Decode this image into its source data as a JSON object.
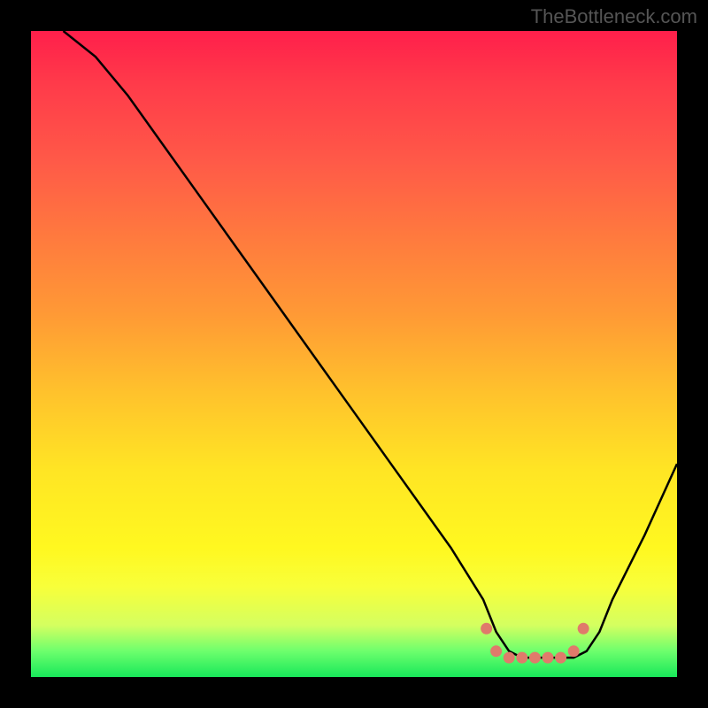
{
  "watermark": "TheBottleneck.com",
  "chart_data": {
    "type": "line",
    "title": "",
    "xlabel": "",
    "ylabel": "",
    "xlim": [
      0,
      100
    ],
    "ylim": [
      0,
      100
    ],
    "x": [
      5,
      10,
      15,
      20,
      25,
      30,
      35,
      40,
      45,
      50,
      55,
      60,
      65,
      70,
      72,
      74,
      76,
      78,
      80,
      82,
      84,
      86,
      88,
      90,
      95,
      100
    ],
    "values": [
      100,
      96,
      90,
      83,
      76,
      69,
      62,
      55,
      48,
      41,
      34,
      27,
      20,
      12,
      7,
      4,
      3,
      3,
      3,
      3,
      3,
      4,
      7,
      12,
      22,
      33
    ],
    "markers_x": [
      70.5,
      72,
      74,
      76,
      78,
      80,
      82,
      84,
      85.5
    ],
    "markers_y": [
      7.5,
      4,
      3,
      3,
      3,
      3,
      3,
      4,
      7.5
    ],
    "marker_color": "#e07a6b",
    "line_color": "#000000",
    "gradient_stops": [
      {
        "pos": 0,
        "color": "#ff1f4b"
      },
      {
        "pos": 100,
        "color": "#18e85a"
      }
    ]
  }
}
